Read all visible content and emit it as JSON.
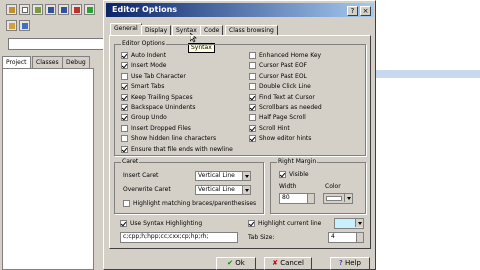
{
  "dialog": {
    "title": "Editor Options",
    "tabs": [
      "General",
      "Display",
      "Syntax",
      "Code",
      "Class browsing"
    ],
    "tooltip": "Syntax",
    "editor_options": {
      "label": "Editor Options",
      "left": [
        {
          "label": "Auto Indent",
          "checked": true
        },
        {
          "label": "Insert Mode",
          "checked": true
        },
        {
          "label": "Use Tab Character",
          "checked": false
        },
        {
          "label": "Smart Tabs",
          "checked": true
        },
        {
          "label": "Keep Trailing Spaces",
          "checked": true
        },
        {
          "label": "Backspace Unindents",
          "checked": true
        },
        {
          "label": "Group Undo",
          "checked": true
        },
        {
          "label": "Insert Dropped Files",
          "checked": false
        },
        {
          "label": "Show hidden line characters",
          "checked": false
        },
        {
          "label": "Ensure that file ends with newline",
          "checked": true
        }
      ],
      "right": [
        {
          "label": "Enhanced Home Key",
          "checked": false
        },
        {
          "label": "Cursor Past EOF",
          "checked": false
        },
        {
          "label": "Cursor Past EOL",
          "checked": false
        },
        {
          "label": "Double Click Line",
          "checked": false
        },
        {
          "label": "Find Text at Cursor",
          "checked": true
        },
        {
          "label": "Scrollbars as needed",
          "checked": true
        },
        {
          "label": "Half Page Scroll",
          "checked": false
        },
        {
          "label": "Scroll Hint",
          "checked": true
        },
        {
          "label": "Show editor hints",
          "checked": true
        }
      ]
    },
    "caret": {
      "label": "Caret",
      "insert_label": "Insert Caret",
      "insert_value": "Vertical Line",
      "overwrite_label": "Overwrite Caret",
      "overwrite_value": "Vertical Line",
      "highlight_label": "Highlight matching braces/parenthesises",
      "highlight_checked": false
    },
    "right_margin": {
      "label": "Right Margin",
      "visible_label": "Visible",
      "visible_checked": true,
      "width_label": "Width",
      "width_value": "80",
      "color_label": "Color"
    },
    "syntax": {
      "use_label": "Use Syntax Highlighting",
      "use_checked": true,
      "extensions": "c;cpp;h;hpp;cc;cxx;cp;hp;rh;",
      "highlight_line_label": "Highlight current line",
      "highlight_line_checked": true,
      "highlight_color": "#c8f0ff",
      "tab_size_label": "Tab Size:",
      "tab_size_value": "4"
    },
    "buttons": {
      "ok": "Ok",
      "cancel": "Cancel",
      "help": "Help"
    }
  },
  "ide": {
    "tabs": [
      "Project",
      "Classes",
      "Debug"
    ]
  }
}
